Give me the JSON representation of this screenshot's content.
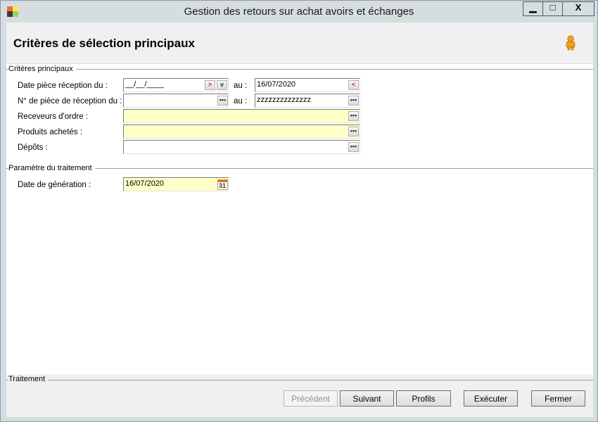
{
  "window": {
    "title": "Gestion des retours sur achat avoirs et échanges",
    "controls": {
      "minimize": "▁",
      "maximize": "□",
      "close": "X"
    }
  },
  "header": {
    "title": "Critères de sélection principaux",
    "user_icon": "user-icon"
  },
  "criteria_group": {
    "label": "Critères principaux",
    "date_piece": {
      "label": "Date pièce réception du :",
      "from_value": "__/__/____",
      "to_label": "au :",
      "to_value": "16/07/2020"
    },
    "num_piece": {
      "label": "N° de pièce de réception du :",
      "from_value": "",
      "to_label": "au :",
      "to_value": "zzzzzzzzzzzzzz"
    },
    "receveurs": {
      "label": "Receveurs d'ordre :",
      "value": ""
    },
    "produits": {
      "label": "Produits achetés :",
      "value": ""
    },
    "depots": {
      "label": "Dépôts :",
      "value": ""
    },
    "browse_glyph": "•••",
    "calendar_day": "31"
  },
  "params_group": {
    "label": "Paramètre du traitement",
    "date_generation": {
      "label": "Date de génération :",
      "value": "16/07/2020"
    }
  },
  "footer": {
    "label": "Traitement",
    "buttons": {
      "precedent": "Précédent",
      "suivant": "Suivant",
      "profils": "Profils",
      "executer": "Exécuter",
      "fermer": "Fermer"
    }
  },
  "colors": {
    "required_field": "#ffffc8",
    "accent_icon": "#e07020"
  }
}
